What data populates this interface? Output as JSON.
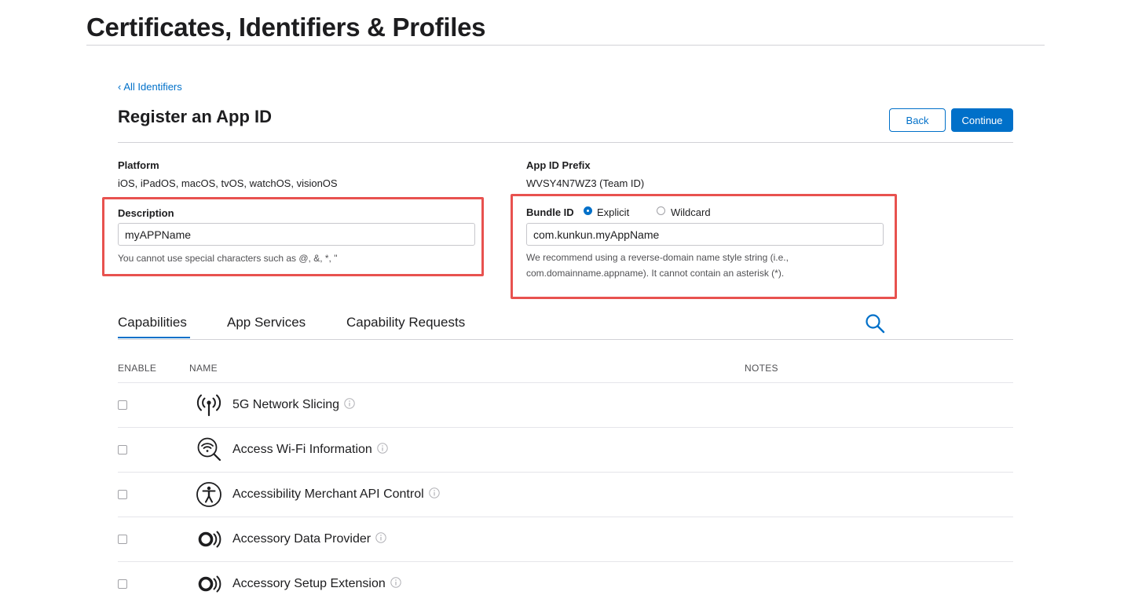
{
  "header": {
    "title": "Certificates, Identifiers & Profiles"
  },
  "nav": {
    "back_link": "All Identifiers"
  },
  "section": {
    "title": "Register an App ID"
  },
  "buttons": {
    "back": "Back",
    "continue": "Continue"
  },
  "platform": {
    "label": "Platform",
    "value": "iOS, iPadOS, macOS, tvOS, watchOS, visionOS"
  },
  "prefix": {
    "label": "App ID Prefix",
    "value": "WVSY4N7WZ3 (Team ID)"
  },
  "description": {
    "label": "Description",
    "value": "myAPPName",
    "hint": "You cannot use special characters such as @, &, *, \""
  },
  "bundle_id": {
    "label": "Bundle ID",
    "options": [
      {
        "label": "Explicit",
        "selected": true
      },
      {
        "label": "Wildcard",
        "selected": false
      }
    ],
    "value": "com.kunkun.myAppName",
    "hint_line1": "We recommend using a reverse-domain name style string (i.e.,",
    "hint_line2": "com.domainname.appname). It cannot contain an asterisk (*)."
  },
  "tabs": [
    {
      "label": "Capabilities",
      "active": true
    },
    {
      "label": "App Services",
      "active": false
    },
    {
      "label": "Capability Requests",
      "active": false
    }
  ],
  "table": {
    "columns": {
      "enable": "ENABLE",
      "name": "NAME",
      "notes": "NOTES"
    },
    "rows": [
      {
        "name": "5G Network Slicing",
        "icon": "antenna-icon",
        "checked": false
      },
      {
        "name": "Access Wi-Fi Information",
        "icon": "wifi-search-icon",
        "checked": false
      },
      {
        "name": "Accessibility Merchant API Control",
        "icon": "accessibility-icon",
        "checked": false
      },
      {
        "name": "Accessory Data Provider",
        "icon": "accessory-icon",
        "checked": false
      },
      {
        "name": "Accessory Setup Extension",
        "icon": "accessory-icon",
        "checked": false
      }
    ]
  },
  "colors": {
    "accent": "#0070c9",
    "highlight": "#e8524f"
  }
}
